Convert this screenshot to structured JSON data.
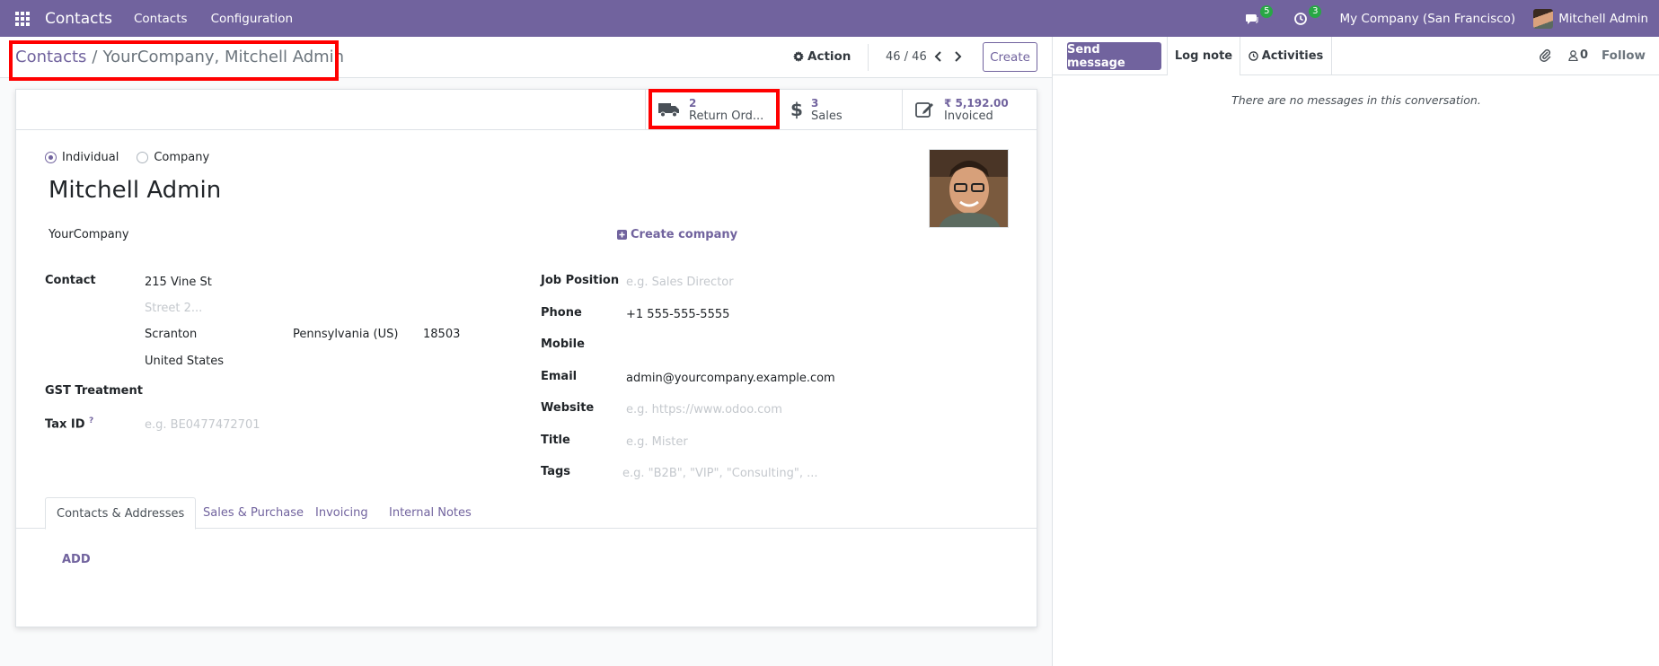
{
  "navbar": {
    "app_name": "Contacts",
    "menus": [
      "Contacts",
      "Configuration"
    ],
    "messages_count": "5",
    "activities_count": "3",
    "company": "My Company (San Francisco)",
    "user": "Mitchell Admin"
  },
  "control_panel": {
    "breadcrumb_root": "Contacts",
    "breadcrumb_sep": "/",
    "breadcrumb_current": "YourCompany, Mitchell Admin",
    "action_label": "Action",
    "pager": "46 / 46",
    "create_label": "Create"
  },
  "smart_buttons": [
    {
      "value": "2",
      "label": "Return Ord...",
      "icon": "truck-icon"
    },
    {
      "value": "3",
      "label": "Sales",
      "icon": "dollar-icon"
    },
    {
      "value": "₹ 5,192.00",
      "label": "Invoiced",
      "icon": "pencil-square-icon"
    }
  ],
  "form": {
    "company_type": {
      "options": [
        "Individual",
        "Company"
      ],
      "selected": "Individual"
    },
    "name": "Mitchell Admin",
    "parent_company": "YourCompany",
    "create_company": "Create company",
    "address": {
      "label": "Contact",
      "street": "215 Vine St",
      "street2_placeholder": "Street 2...",
      "city": "Scranton",
      "state": "Pennsylvania (US)",
      "zip": "18503",
      "country": "United States"
    },
    "gst_label": "GST Treatment",
    "tax_id_label": "Tax ID",
    "tax_id_tooltip": "?",
    "tax_id_placeholder": "e.g. BE0477472701",
    "job_position_label": "Job Position",
    "job_position_placeholder": "e.g. Sales Director",
    "phone_label": "Phone",
    "phone": "+1 555-555-5555",
    "mobile_label": "Mobile",
    "email_label": "Email",
    "email": "admin@yourcompany.example.com",
    "website_label": "Website",
    "website_placeholder": "e.g. https://www.odoo.com",
    "title_label": "Title",
    "title_placeholder": "e.g. Mister",
    "tags_label": "Tags",
    "tags_placeholder": "e.g. \"B2B\", \"VIP\", \"Consulting\", ..."
  },
  "notebook": {
    "tabs": [
      "Contacts & Addresses",
      "Sales & Purchase",
      "Invoicing",
      "Internal Notes"
    ],
    "active_tab": "Contacts & Addresses",
    "add_label": "ADD"
  },
  "chatter": {
    "send_message": "Send message",
    "log_note": "Log note",
    "activities": "Activities",
    "followers_count": "0",
    "follow": "Follow",
    "empty_text": "There are no messages in this conversation."
  },
  "colors": {
    "brand": "#71639e",
    "highlight": "#ff0000",
    "badge": "#28a745"
  }
}
